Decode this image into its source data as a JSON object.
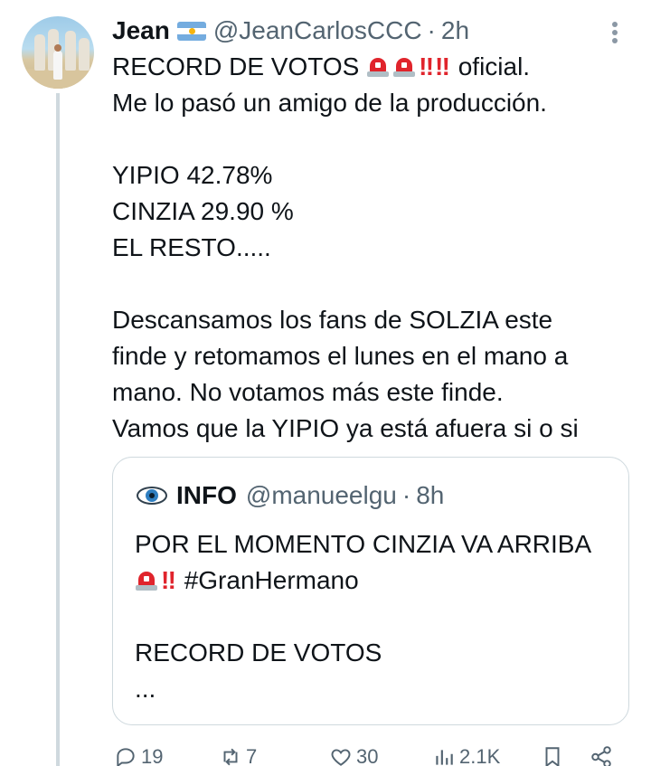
{
  "tweet": {
    "author_name": "Jean",
    "author_flag": "argentina-flag",
    "handle": "@JeanCarlosCCC",
    "separator": "·",
    "time": "2h",
    "line1_prefix": "RECORD DE VOTOS",
    "line1_suffix": "oficial.",
    "line2": "Me lo pasó un amigo de la producción.",
    "line3": "YIPIO 42.78%",
    "line4": "CINZIA 29.90 %",
    "line5": "EL RESTO.....",
    "line6": "Descansamos los fans de SOLZIA este",
    "line7": "finde y retomamos el lunes en el mano a",
    "line8": "mano. No votamos más este finde.",
    "line9": "Vamos que la YIPIO ya está afuera si o si",
    "bang": "‼",
    "alert_icon": "police-light-emoji"
  },
  "quote": {
    "icon": "eye-emoji",
    "name": "INFO",
    "handle": "@manueelgu",
    "separator": "·",
    "time": "8h",
    "line1": "POR EL MOMENTO CINZIA VA ARRIBA",
    "line2_suffix": "#GranHermano",
    "line3": "RECORD DE VOTOS",
    "line4": "..."
  },
  "actions": {
    "replies": "19",
    "retweets": "7",
    "likes": "30",
    "views": "2.1K"
  },
  "colors": {
    "text": "#0f1419",
    "secondary": "#536471",
    "border": "#cfd9de",
    "alert_red": "#e0242c"
  }
}
